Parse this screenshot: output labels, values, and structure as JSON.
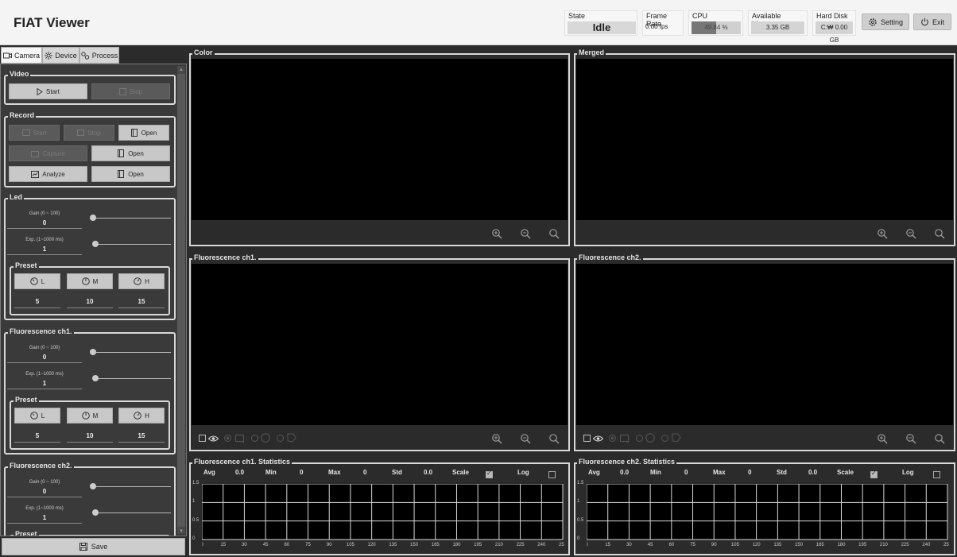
{
  "app": {
    "title": "FIAT Viewer"
  },
  "header": {
    "state": {
      "label": "State",
      "value": "Idle"
    },
    "frame_rate": {
      "label": "Frame Rate",
      "value": "0.00 fps"
    },
    "cpu": {
      "label": "CPU",
      "value": "49.84 %",
      "percent": 49.84
    },
    "memory": {
      "label": "Available Memory",
      "value": "3.35 GB"
    },
    "disk": {
      "label": "Hard Disk",
      "value": "C:₩ 0.00 GB"
    },
    "setting_label": "Setting",
    "exit_label": "Exit"
  },
  "tabs": [
    {
      "label": "Camera",
      "icon": "camera-icon"
    },
    {
      "label": "Device",
      "icon": "sun-icon"
    },
    {
      "label": "Process",
      "icon": "process-icon"
    }
  ],
  "video": {
    "label": "Video",
    "start": "Start",
    "stop": "Stop"
  },
  "record": {
    "label": "Record",
    "start": "Start",
    "stop": "Stop",
    "open1": "Open",
    "capture": "Capture",
    "open2": "Open",
    "analyze": "Analyze",
    "open3": "Open"
  },
  "led": {
    "label": "Led",
    "gain_label": "Gain (0 ~ 100)",
    "gain_value": "0",
    "exp_label": "Exp. (1~1000 ms)",
    "exp_value": "1",
    "preset": {
      "label": "Preset",
      "l": "L",
      "m": "M",
      "h": "H",
      "l_value": "5",
      "m_value": "10",
      "h_value": "15"
    }
  },
  "fluo1": {
    "label": "Fluorescence ch1.",
    "gain_label": "Gain (0 ~ 100)",
    "gain_value": "0",
    "exp_label": "Exp. (1~1000 ms)",
    "exp_value": "1",
    "preset": {
      "label": "Preset",
      "l": "L",
      "m": "M",
      "h": "H",
      "l_value": "5",
      "m_value": "10",
      "h_value": "15"
    }
  },
  "fluo2": {
    "label": "Fluorescence ch2.",
    "gain_label": "Gain (0 ~ 100)",
    "gain_value": "0",
    "exp_label": "Exp. (1~1000 ms)",
    "exp_value": "1",
    "preset": {
      "label": "Preset"
    }
  },
  "save_label": "Save",
  "panels": {
    "color": "Color",
    "merged": "Merged",
    "fluo1": "Fluorescence ch1.",
    "fluo2": "Fluorescence ch2."
  },
  "stats": [
    {
      "title": "Fluorescence ch1. Statistics",
      "avg_label": "Avg",
      "avg": "0.0",
      "min_label": "Min",
      "min": "0",
      "max_label": "Max",
      "max": "0",
      "std_label": "Std",
      "std": "0.0",
      "scale_label": "Scale",
      "log_label": "Log",
      "scale_checked": true,
      "log_checked": false
    },
    {
      "title": "Fluorescence ch2. Statistics",
      "avg_label": "Avg",
      "avg": "0.0",
      "min_label": "Min",
      "min": "0",
      "max_label": "Max",
      "max": "0",
      "std_label": "Std",
      "std": "0.0",
      "scale_label": "Scale",
      "log_label": "Log",
      "scale_checked": true,
      "log_checked": false
    }
  ],
  "chart_data": [
    {
      "type": "line",
      "title": "Fluorescence ch1. Statistics",
      "xticks": [
        "0",
        "15",
        "30",
        "45",
        "60",
        "75",
        "90",
        "105",
        "120",
        "135",
        "150",
        "165",
        "180",
        "195",
        "210",
        "225",
        "240",
        "255"
      ],
      "yticks": [
        "0",
        "0.5",
        "1",
        "1.5"
      ],
      "xlim": [
        0,
        255
      ],
      "ylim": [
        0,
        1.5
      ],
      "grid": true,
      "series": []
    },
    {
      "type": "line",
      "title": "Fluorescence ch2. Statistics",
      "xticks": [
        "0",
        "15",
        "30",
        "45",
        "60",
        "75",
        "90",
        "105",
        "120",
        "135",
        "150",
        "165",
        "180",
        "195",
        "210",
        "225",
        "240",
        "255"
      ],
      "yticks": [
        "0",
        "0.5",
        "1",
        "1.5"
      ],
      "xlim": [
        0,
        255
      ],
      "ylim": [
        0,
        1.5
      ],
      "grid": true,
      "series": []
    }
  ]
}
